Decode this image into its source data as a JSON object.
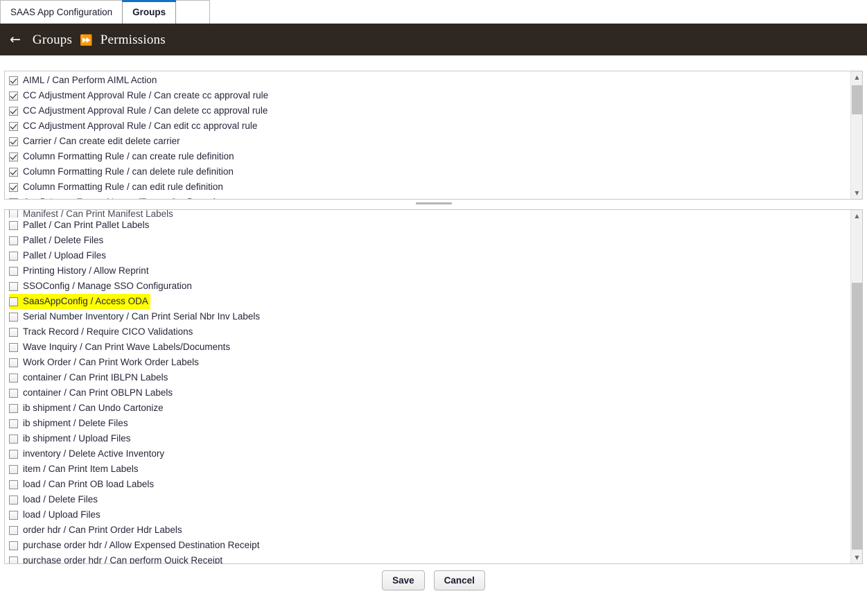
{
  "tabs": [
    {
      "label": "SAAS App Configuration",
      "active": false
    },
    {
      "label": "Groups",
      "active": true
    }
  ],
  "header": {
    "back_icon": "←",
    "separator": "⏩",
    "crumb_parent": "Groups",
    "crumb_current": "Permissions",
    "background": "#2e2722"
  },
  "top_panel": {
    "scrollbar": {
      "up": "▲",
      "down": "▼"
    },
    "items": [
      {
        "label": "AIML / Can Perform AIML Action",
        "checked": true
      },
      {
        "label": "CC Adjustment Approval Rule / Can create cc approval rule",
        "checked": true
      },
      {
        "label": "CC Adjustment Approval Rule / Can delete cc approval rule",
        "checked": true
      },
      {
        "label": "CC Adjustment Approval Rule / Can edit cc approval rule",
        "checked": true
      },
      {
        "label": "Carrier / Can create edit delete carrier",
        "checked": true
      },
      {
        "label": "Column Formatting Rule / can create rule definition",
        "checked": true
      },
      {
        "label": "Column Formatting Rule / can delete rule definition",
        "checked": true
      },
      {
        "label": "Column Formatting Rule / can edit rule definition",
        "checked": true
      },
      {
        "label": "ConfigImportExport / Import/Export Configuration",
        "checked": true
      }
    ]
  },
  "bottom_panel": {
    "scrollbar": {
      "up": "▲",
      "down": "▼"
    },
    "clipped_item": {
      "label": "Manifest / Can Print Manifest Labels",
      "checked": false
    },
    "items": [
      {
        "label": "Pallet / Can Print Pallet Labels",
        "checked": false,
        "highlighted": false
      },
      {
        "label": "Pallet / Delete Files",
        "checked": false,
        "highlighted": false
      },
      {
        "label": "Pallet / Upload Files",
        "checked": false,
        "highlighted": false
      },
      {
        "label": "Printing History / Allow Reprint",
        "checked": false,
        "highlighted": false
      },
      {
        "label": "SSOConfig / Manage SSO Configuration",
        "checked": false,
        "highlighted": false
      },
      {
        "label": "SaasAppConfig / Access ODA",
        "checked": false,
        "highlighted": true
      },
      {
        "label": "Serial Number Inventory / Can Print Serial Nbr Inv Labels",
        "checked": false,
        "highlighted": false
      },
      {
        "label": "Track Record / Require CICO Validations",
        "checked": false,
        "highlighted": false
      },
      {
        "label": "Wave Inquiry / Can Print Wave Labels/Documents",
        "checked": false,
        "highlighted": false
      },
      {
        "label": "Work Order / Can Print Work Order Labels",
        "checked": false,
        "highlighted": false
      },
      {
        "label": "container / Can Print IBLPN Labels",
        "checked": false,
        "highlighted": false
      },
      {
        "label": "container / Can Print OBLPN Labels",
        "checked": false,
        "highlighted": false
      },
      {
        "label": "ib shipment / Can Undo Cartonize",
        "checked": false,
        "highlighted": false
      },
      {
        "label": "ib shipment / Delete Files",
        "checked": false,
        "highlighted": false
      },
      {
        "label": "ib shipment / Upload Files",
        "checked": false,
        "highlighted": false
      },
      {
        "label": "inventory / Delete Active Inventory",
        "checked": false,
        "highlighted": false
      },
      {
        "label": "item / Can Print Item Labels",
        "checked": false,
        "highlighted": false
      },
      {
        "label": "load / Can Print OB load Labels",
        "checked": false,
        "highlighted": false
      },
      {
        "label": "load / Delete Files",
        "checked": false,
        "highlighted": false
      },
      {
        "label": "load / Upload Files",
        "checked": false,
        "highlighted": false
      },
      {
        "label": "order hdr / Can Print Order Hdr Labels",
        "checked": false,
        "highlighted": false
      },
      {
        "label": "purchase order hdr / Allow Expensed Destination Receipt",
        "checked": false,
        "highlighted": false
      },
      {
        "label": "purchase order hdr / Can perform Quick Receipt",
        "checked": false,
        "highlighted": false
      }
    ]
  },
  "footer": {
    "save_label": "Save",
    "cancel_label": "Cancel"
  },
  "colors": {
    "highlight": "#ffff00",
    "tab_accent": "#1172c4",
    "header_bg": "#2e2722"
  }
}
